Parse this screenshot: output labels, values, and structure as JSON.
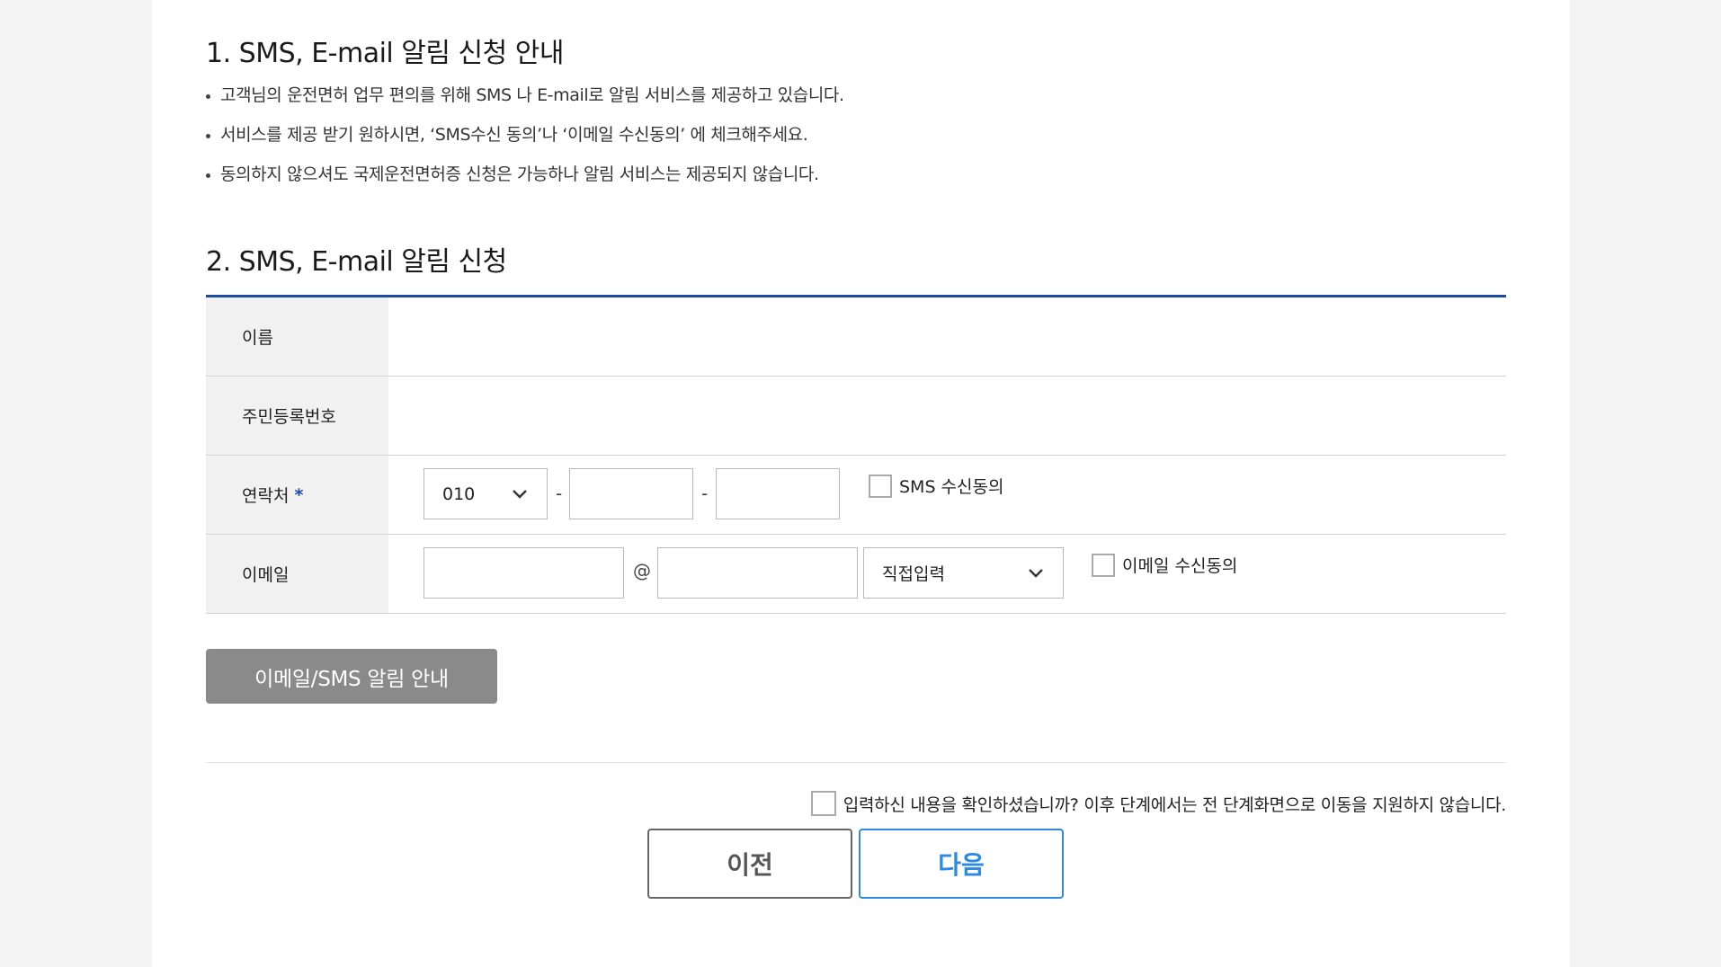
{
  "section1": {
    "title": "1. SMS, E-mail 알림 신청 안내",
    "bullets": [
      "고객님의 운전면허 업무 편의를 위해 SMS 나 E-mail로 알림 서비스를 제공하고 있습니다.",
      "서비스를 제공 받기 원하시면, ‘SMS수신 동의’나 ‘이메일 수신동의’ 에 체크해주세요.",
      "동의하지 않으셔도 국제운전면허증 신청은 가능하나 알림 서비스는 제공되지 않습니다."
    ]
  },
  "section2": {
    "title": "2. SMS, E-mail 알림 신청",
    "labels": {
      "name": "이름",
      "rrn": "주민등록번호",
      "contact": "연락처",
      "required_mark": "*",
      "email": "이메일"
    },
    "phone": {
      "prefix_selected": "010",
      "separator": "-",
      "middle_value": "",
      "last_value": "",
      "sms_consent_label": "SMS 수신동의",
      "sms_consent_checked": false
    },
    "email": {
      "local_value": "",
      "at": "@",
      "domain_value": "",
      "domain_select": "직접입력",
      "email_consent_label": "이메일 수신동의",
      "email_consent_checked": false
    },
    "notice_button": "이메일/SMS 알림 안내"
  },
  "footer": {
    "confirm_label": "입력하신 내용을 확인하셨습니까? 이후 단계에서는 전 단계화면으로 이동을 지원하지 않습니다.",
    "confirm_checked": false,
    "prev_button": "이전",
    "next_button": "다음"
  },
  "colors": {
    "accent_blue": "#1d4c9c",
    "next_blue": "#2d8ae0",
    "gray_button": "#8a8a8a",
    "label_bg": "#f1f1f1"
  }
}
